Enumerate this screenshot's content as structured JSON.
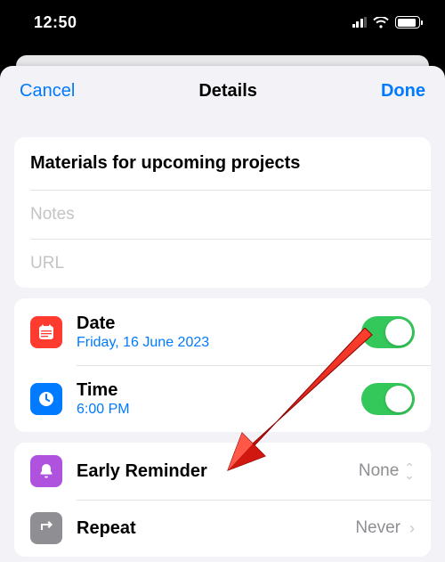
{
  "status": {
    "time": "12:50"
  },
  "nav": {
    "cancel": "Cancel",
    "title": "Details",
    "done": "Done"
  },
  "title_field": {
    "value": "Materials for upcoming projects"
  },
  "notes": {
    "placeholder": "Notes"
  },
  "url": {
    "placeholder": "URL"
  },
  "date": {
    "label": "Date",
    "value": "Friday, 16 June 2023",
    "on": true
  },
  "time": {
    "label": "Time",
    "value": "6:00 PM",
    "on": true
  },
  "early_reminder": {
    "label": "Early Reminder",
    "value": "None"
  },
  "repeat": {
    "label": "Repeat",
    "value": "Never"
  }
}
